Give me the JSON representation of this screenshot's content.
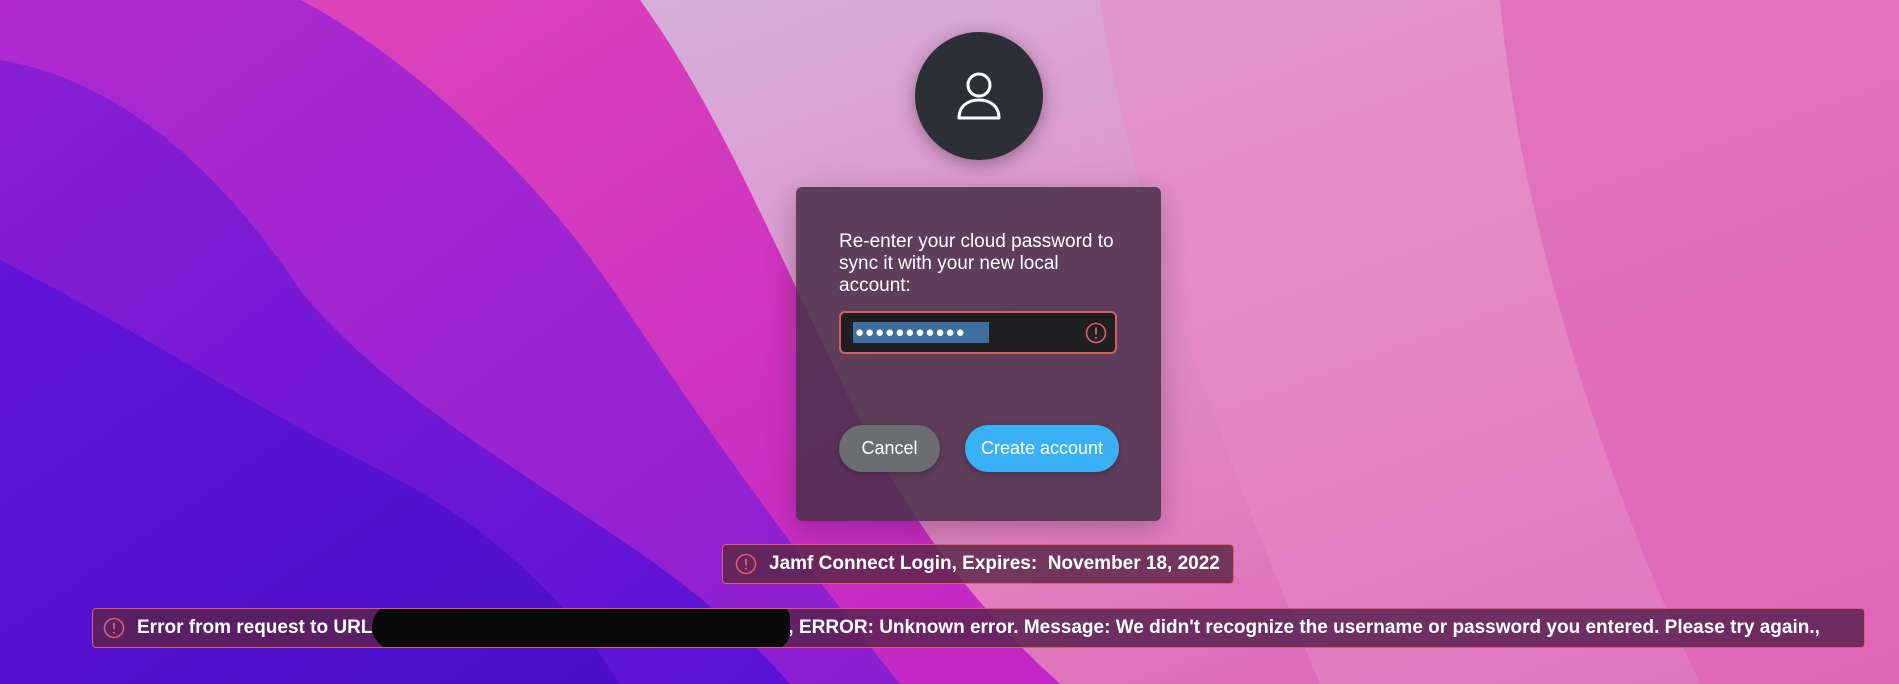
{
  "colors": {
    "accent_button": "#3ab1f5",
    "cancel_button": "#6b6d70",
    "warning": "#e05a68",
    "panel": "#483048"
  },
  "avatar": {
    "icon": "user-silhouette-icon"
  },
  "dialog": {
    "prompt": "Re-enter your cloud password to sync it with your new local account:",
    "password_masked": "●●●●●●●●●●●",
    "password_icon": "warning-icon",
    "cancel_label": "Cancel",
    "create_label": "Create account"
  },
  "notices": {
    "expiry_text": "Jamf Connect Login, Expires:  November 18, 2022",
    "error_prefix": "Error from request to URL",
    "error_suffix": ", ERROR: Unknown error. Message: We didn't recognize the username or password you entered. Please try again.,"
  }
}
